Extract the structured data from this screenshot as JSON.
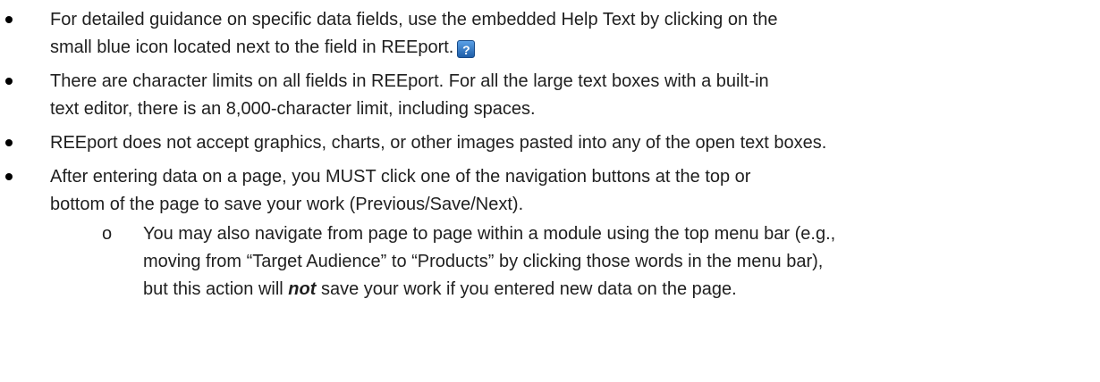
{
  "bullets": [
    {
      "lines": [
        "For detailed guidance on specific data fields, use the embedded Help Text by clicking on the",
        "small blue icon located next to the field in REEport."
      ]
    },
    {
      "lines": [
        "There are character limits on all fields in REEport. For all the large text boxes with a built-in",
        "text editor, there is an 8,000-character limit, including spaces."
      ]
    },
    {
      "lines": [
        "REEport does not accept graphics, charts, or other images pasted into any of the open text boxes."
      ]
    },
    {
      "lines": [
        "After entering data on a page, you MUST click one of the navigation buttons at the top or",
        "bottom of the page to save your work (Previous/Save/Next)."
      ],
      "sub": {
        "marker": "o",
        "lines": [
          "You may also navigate from page to page within a module using the top menu bar (e.g.,",
          "moving from “Target Audience” to “Products” by clicking those words in the menu bar),",
          "but this action will ",
          "not",
          " save your work if you entered new data on the page."
        ]
      }
    }
  ],
  "help_icon": {
    "glyph": "?",
    "icon": "help-icon",
    "color": "#2b6cc0"
  }
}
